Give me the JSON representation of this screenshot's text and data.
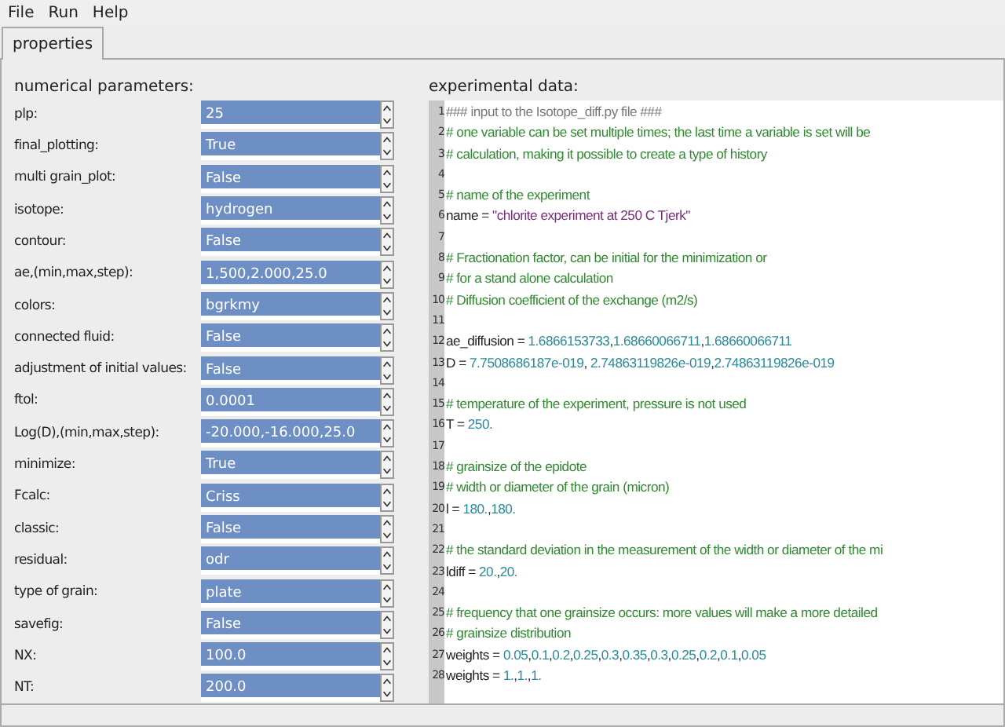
{
  "menu": [
    "File",
    "Run",
    "Help"
  ],
  "tabs": [
    {
      "label": "properties",
      "selected": true
    }
  ],
  "params_title": "numerical parameters:",
  "params": [
    {
      "label": "plp:",
      "value": "25"
    },
    {
      "label": "final_plotting:",
      "value": "True"
    },
    {
      "label": "multi grain_plot:",
      "value": "False"
    },
    {
      "label": "isotope:",
      "value": "hydrogen"
    },
    {
      "label": "contour:",
      "value": "False"
    },
    {
      "label": "ae,(min,max,step):",
      "value": "1,500,2.000,25.0"
    },
    {
      "label": "colors:",
      "value": "bgrkmy"
    },
    {
      "label": "connected fluid:",
      "value": "False"
    },
    {
      "label": "adjustment of initial values:",
      "value": "False"
    },
    {
      "label": "ftol:",
      "value": "0.0001"
    },
    {
      "label": "Log(D),(min,max,step):",
      "value": "-20.000,-16.000,25.0"
    },
    {
      "label": "minimize:",
      "value": "True"
    },
    {
      "label": "Fcalc:",
      "value": "Criss"
    },
    {
      "label": "classic:",
      "value": "False"
    },
    {
      "label": "residual:",
      "value": "odr"
    },
    {
      "label": "type of grain:",
      "value": "plate"
    },
    {
      "label": "savefig:",
      "value": "False"
    },
    {
      "label": "NX:",
      "value": "100.0"
    },
    {
      "label": "NT:",
      "value": "200.0"
    }
  ],
  "editor_title": "experimental data:",
  "lines": [
    {
      "number": "1",
      "tokens": [
        {
          "kind": "doc",
          "text": "### input to the Isotope_diff.py file ###"
        }
      ]
    },
    {
      "number": "2",
      "tokens": [
        {
          "kind": "comment",
          "text": "# one variable can be set multiple times; the last time a variable is set will be"
        }
      ]
    },
    {
      "number": "3",
      "tokens": [
        {
          "kind": "comment",
          "text": "# calculation, making it possible to create a type of history"
        }
      ]
    },
    {
      "number": "4"
    },
    {
      "number": "5",
      "tokens": [
        {
          "kind": "comment",
          "text": "# name of the experiment"
        }
      ]
    },
    {
      "number": "6",
      "tokens": [
        {
          "kind": "text",
          "text": "name = "
        },
        {
          "kind": "string",
          "text": "\"chlorite experiment at 250 C Tjerk\""
        }
      ]
    },
    {
      "number": "7"
    },
    {
      "number": "8",
      "tokens": [
        {
          "kind": "comment",
          "text": "# Fractionation factor, can be initial for the minimization or"
        }
      ]
    },
    {
      "number": "9",
      "tokens": [
        {
          "kind": "comment",
          "text": "# for a stand alone calculation"
        }
      ]
    },
    {
      "number": "10",
      "tokens": [
        {
          "kind": "comment",
          "text": "# Diffusion coefficient of the exchange (m2/s)"
        }
      ]
    },
    {
      "number": "11"
    },
    {
      "number": "12",
      "tokens": [
        {
          "kind": "text",
          "text": "ae_diffusion = "
        },
        {
          "kind": "number",
          "text": "1.6866153733"
        },
        {
          "kind": "text",
          "text": ","
        },
        {
          "kind": "number",
          "text": "1.68660066711"
        },
        {
          "kind": "text",
          "text": ","
        },
        {
          "kind": "number",
          "text": "1.68660066711"
        }
      ]
    },
    {
      "number": "13",
      "tokens": [
        {
          "kind": "text",
          "text": "D = "
        },
        {
          "kind": "number",
          "text": "7.7508686187e-019"
        },
        {
          "kind": "text",
          "text": ", "
        },
        {
          "kind": "number",
          "text": "2.74863119826e-019"
        },
        {
          "kind": "text",
          "text": ","
        },
        {
          "kind": "number",
          "text": "2.74863119826e-019"
        }
      ]
    },
    {
      "number": "14"
    },
    {
      "number": "15",
      "tokens": [
        {
          "kind": "comment",
          "text": "# temperature of the experiment, pressure is not used"
        }
      ]
    },
    {
      "number": "16",
      "tokens": [
        {
          "kind": "text",
          "text": "T = "
        },
        {
          "kind": "number",
          "text": "250."
        }
      ]
    },
    {
      "number": "17"
    },
    {
      "number": "18",
      "tokens": [
        {
          "kind": "comment",
          "text": "# grainsize of the epidote"
        }
      ]
    },
    {
      "number": "19",
      "tokens": [
        {
          "kind": "comment",
          "text": "# width or diameter of the grain (micron)"
        }
      ]
    },
    {
      "number": "20",
      "tokens": [
        {
          "kind": "text",
          "text": "l = "
        },
        {
          "kind": "number",
          "text": "180."
        },
        {
          "kind": "text",
          "text": ","
        },
        {
          "kind": "number",
          "text": "180."
        }
      ]
    },
    {
      "number": "21"
    },
    {
      "number": "22",
      "tokens": [
        {
          "kind": "comment",
          "text": "# the standard deviation in the measurement of the width or diameter of the mi"
        }
      ]
    },
    {
      "number": "23",
      "tokens": [
        {
          "kind": "text",
          "text": "ldiff = "
        },
        {
          "kind": "number",
          "text": "20."
        },
        {
          "kind": "text",
          "text": ","
        },
        {
          "kind": "number",
          "text": "20."
        }
      ]
    },
    {
      "number": "24"
    },
    {
      "number": "25",
      "tokens": [
        {
          "kind": "comment",
          "text": "# frequency that one grainsize occurs: more values will make a more detailed"
        }
      ]
    },
    {
      "number": "26",
      "tokens": [
        {
          "kind": "comment",
          "text": "# grainsize distribution"
        }
      ]
    },
    {
      "number": "27",
      "tokens": [
        {
          "kind": "text",
          "text": "weights = "
        },
        {
          "kind": "number",
          "text": "0.05"
        },
        {
          "kind": "text",
          "text": ","
        },
        {
          "kind": "number",
          "text": "0.1"
        },
        {
          "kind": "text",
          "text": ","
        },
        {
          "kind": "number",
          "text": "0.2"
        },
        {
          "kind": "text",
          "text": ","
        },
        {
          "kind": "number",
          "text": "0.25"
        },
        {
          "kind": "text",
          "text": ","
        },
        {
          "kind": "number",
          "text": "0.3"
        },
        {
          "kind": "text",
          "text": ","
        },
        {
          "kind": "number",
          "text": "0.35"
        },
        {
          "kind": "text",
          "text": ","
        },
        {
          "kind": "number",
          "text": "0.3"
        },
        {
          "kind": "text",
          "text": ","
        },
        {
          "kind": "number",
          "text": "0.25"
        },
        {
          "kind": "text",
          "text": ","
        },
        {
          "kind": "number",
          "text": "0.2"
        },
        {
          "kind": "text",
          "text": ","
        },
        {
          "kind": "number",
          "text": "0.1"
        },
        {
          "kind": "text",
          "text": ","
        },
        {
          "kind": "number",
          "text": "0.05"
        }
      ]
    },
    {
      "number": "28",
      "tokens": [
        {
          "kind": "text",
          "text": "weights = "
        },
        {
          "kind": "number",
          "text": "1."
        },
        {
          "kind": "text",
          "text": ","
        },
        {
          "kind": "number",
          "text": "1."
        },
        {
          "kind": "text",
          "text": ","
        },
        {
          "kind": "number",
          "text": "1."
        }
      ]
    }
  ]
}
